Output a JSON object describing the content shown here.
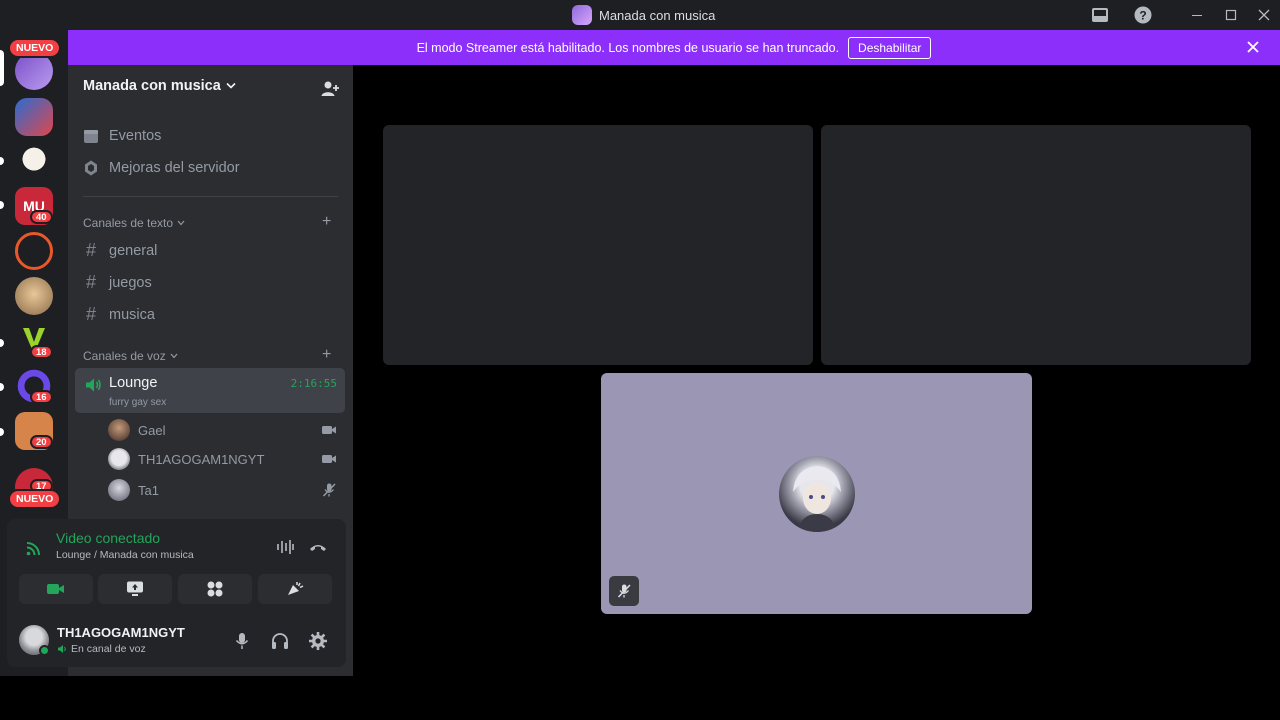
{
  "window": {
    "title": "Manada con musica"
  },
  "banner": {
    "text": "El modo Streamer está habilitado. Los nombres de usuario se han truncado.",
    "button": "Deshabilitar"
  },
  "rail": {
    "badges": [
      "NUEVO",
      "NUEVO"
    ],
    "counts": [
      "40",
      "18",
      "16",
      "20",
      "17"
    ],
    "server_tile_label": "MU"
  },
  "sidebar": {
    "server_name": "Manada con musica",
    "items": [
      {
        "label": "Eventos",
        "icon": "calendar-icon"
      },
      {
        "label": "Mejoras del servidor",
        "icon": "boost-icon"
      }
    ],
    "text_category": "Canales de texto",
    "text_channels": [
      "general",
      "juegos",
      "musica"
    ],
    "voice_category": "Canales de voz",
    "voice_channel": {
      "name": "Lounge",
      "status": "furry gay sex",
      "timer": "2:16:55"
    },
    "members": [
      {
        "name": "Gael",
        "icon": "video-icon"
      },
      {
        "name": "TH1AGOGAM1NGYT",
        "icon": "video-icon"
      },
      {
        "name": "Ta1",
        "icon": "mic-muted-icon"
      }
    ]
  },
  "voice_panel": {
    "title": "Video conectado",
    "subtitle": "Lounge / Manada con musica"
  },
  "user": {
    "name": "TH1AGOGAM1NGYT",
    "status": "En canal de voz"
  },
  "colors": {
    "banner": "#8c2ffa",
    "connected_green": "#23a55a",
    "active_tile": "#9c96b5"
  }
}
